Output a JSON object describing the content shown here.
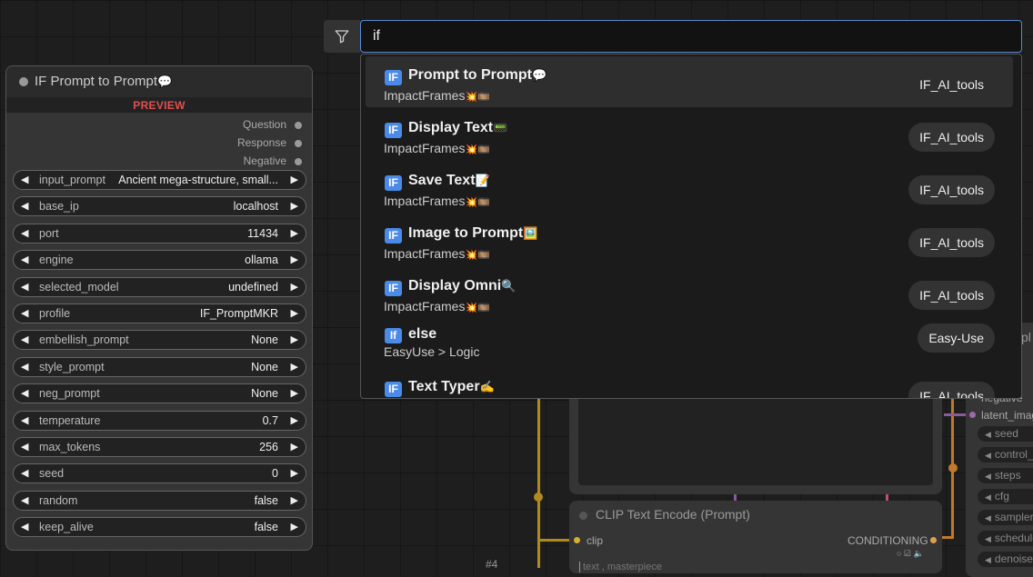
{
  "search": {
    "value": "if",
    "filter_icon": "filter-icon"
  },
  "results": [
    {
      "icon": "IF",
      "name": "Prompt to Prompt",
      "emoji": "💬",
      "sub": "ImpactFrames",
      "sub_emoji": "💥🎞️",
      "badge": "IF_AI_tools",
      "selected": true
    },
    {
      "icon": "IF",
      "name": "Display Text",
      "emoji": "📟",
      "sub": "ImpactFrames",
      "sub_emoji": "💥🎞️",
      "badge": "IF_AI_tools",
      "selected": false
    },
    {
      "icon": "IF",
      "name": "Save Text",
      "emoji": "📝",
      "sub": "ImpactFrames",
      "sub_emoji": "💥🎞️",
      "badge": "IF_AI_tools",
      "selected": false
    },
    {
      "icon": "IF",
      "name": "Image to Prompt",
      "emoji": "🖼️",
      "sub": "ImpactFrames",
      "sub_emoji": "💥🎞️",
      "badge": "IF_AI_tools",
      "selected": false
    },
    {
      "icon": "IF",
      "name": "Display Omni",
      "emoji": "🔍",
      "sub": "ImpactFrames",
      "sub_emoji": "💥🎞️",
      "badge": "IF_AI_tools",
      "selected": false
    },
    {
      "icon": "If",
      "name": "else",
      "emoji": "",
      "sub": "EasyUse > Logic",
      "sub_emoji": "",
      "badge": "Easy-Use",
      "selected": false
    },
    {
      "icon": "IF",
      "name": "Text Typer",
      "emoji": "✍️",
      "sub": "",
      "sub_emoji": "",
      "badge": "IF_AI_tools",
      "selected": false
    }
  ],
  "node": {
    "title": "IF Prompt to Prompt",
    "title_emoji": "💬",
    "preview_label": "PREVIEW",
    "outputs": [
      "Question",
      "Response",
      "Negative"
    ],
    "widgets": [
      {
        "label": "input_prompt",
        "value": "Ancient mega-structure, small..."
      },
      {
        "label": "base_ip",
        "value": "localhost"
      },
      {
        "label": "port",
        "value": "11434"
      },
      {
        "label": "engine",
        "value": "ollama"
      },
      {
        "label": "selected_model",
        "value": "undefined"
      },
      {
        "label": "profile",
        "value": "IF_PromptMKR"
      },
      {
        "label": "embellish_prompt",
        "value": "None"
      },
      {
        "label": "style_prompt",
        "value": "None"
      },
      {
        "label": "neg_prompt",
        "value": "None"
      },
      {
        "label": "temperature",
        "value": "0.7"
      },
      {
        "label": "max_tokens",
        "value": "256"
      },
      {
        "label": "seed",
        "value": "0"
      },
      {
        "label": "random",
        "value": "false"
      },
      {
        "label": "keep_alive",
        "value": "false"
      }
    ],
    "arrow_left": "◀",
    "arrow_right": "▶"
  },
  "background": {
    "clip_title": "CLIP Text Encode (Prompt)",
    "clip_port": "clip",
    "conditioning_port": "CONDITIONING",
    "text_hint": "text , masterpiece",
    "node_number": "#4",
    "ksampler_partial_title": "pl",
    "ksampler_inputs": [
      "negative",
      "latent_imag"
    ],
    "ksampler_widgets": [
      "seed",
      "control_",
      "steps",
      "cfg",
      "sampler_",
      "schedule",
      "denoise"
    ]
  }
}
